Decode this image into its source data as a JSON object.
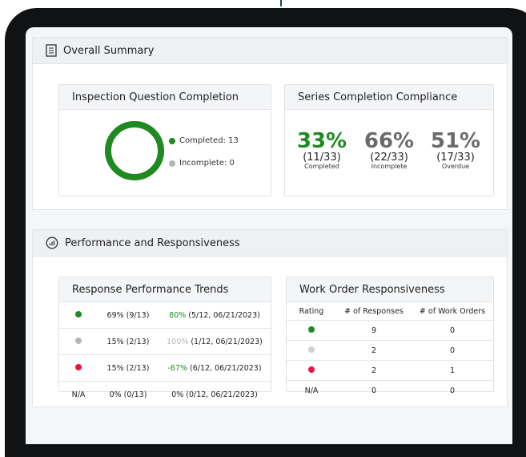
{
  "colors": {
    "green": "#1f8a1f",
    "gray": "#b5b5b5",
    "red": "#e3173e",
    "stat_gray": "#6b6b6b"
  },
  "overall": {
    "title": "Overall Summary",
    "icon": "document-icon",
    "inspection": {
      "title": "Inspection Question Completion",
      "completed_label": "Completed: 13",
      "incomplete_label": "Incomplete: 0",
      "completed_fraction": 1.0
    },
    "series": {
      "title": "Series Completion Compliance",
      "stats": [
        {
          "pct": "33%",
          "frac": "(11/33)",
          "label": "Completed",
          "color": "#1f8a1f"
        },
        {
          "pct": "66%",
          "frac": "(22/33)",
          "label": "Incomplete",
          "color": "#6b6b6b"
        },
        {
          "pct": "51%",
          "frac": "(17/33)",
          "label": "Overdue",
          "color": "#6b6b6b"
        }
      ]
    }
  },
  "performance": {
    "title": "Performance and Responsiveness",
    "icon": "performance-chart-icon",
    "response_trends": {
      "title": "Response Performance Trends",
      "rows": [
        {
          "rating": "green",
          "current": "69% (9/13)",
          "change": "80%",
          "detail": " (5/12, 06/21/2023)",
          "change_color": "#1f8a1f"
        },
        {
          "rating": "gray",
          "current": "15% (2/13)",
          "change": "100%",
          "detail": " (1/12, 06/21/2023)",
          "change_color": "#b5b5b5"
        },
        {
          "rating": "red",
          "current": "15% (2/13)",
          "change": "-67%",
          "detail": " (6/12, 06/21/2023)",
          "change_color": "#1f8a1f"
        },
        {
          "rating": "N/A",
          "current": "0% (0/13)",
          "change": "0%",
          "detail": " (0/12, 06/21/2023)",
          "change_color": "#222222"
        }
      ]
    },
    "work_orders": {
      "title": "Work Order Responsiveness",
      "headers": [
        "Rating",
        "# of Responses",
        "# of Work Orders"
      ],
      "rows": [
        {
          "rating": "green",
          "responses": "9",
          "orders": "0"
        },
        {
          "rating": "gray",
          "responses": "2",
          "orders": "0"
        },
        {
          "rating": "red",
          "responses": "2",
          "orders": "1"
        },
        {
          "rating": "N/A",
          "responses": "0",
          "orders": "0"
        }
      ]
    }
  }
}
